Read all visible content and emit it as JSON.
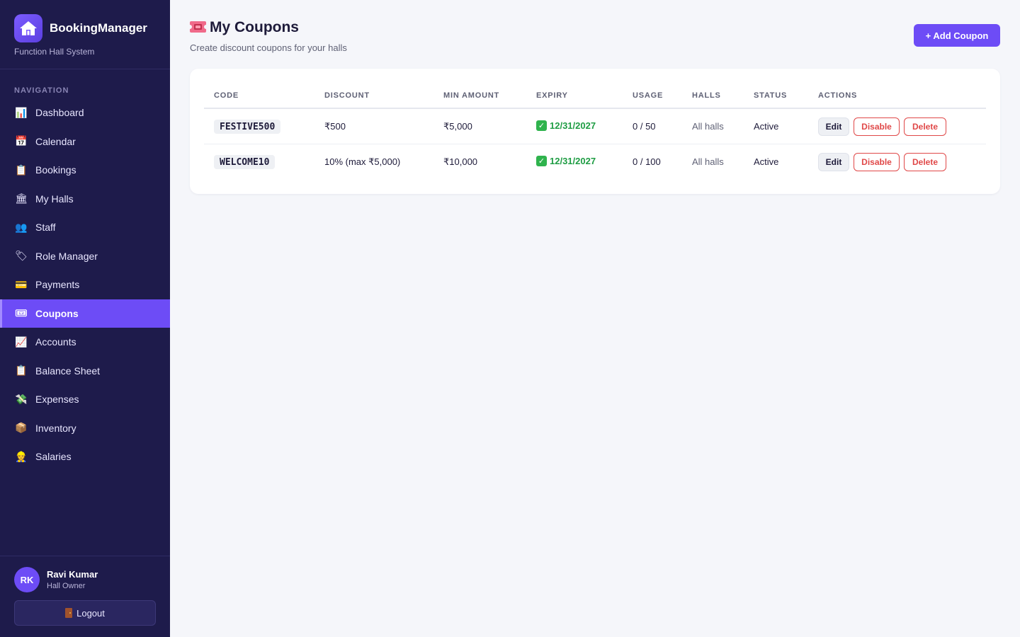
{
  "brand": {
    "title": "BookingManager",
    "subtitle": "Function Hall System"
  },
  "nav": {
    "heading": "NAVIGATION",
    "items": [
      {
        "label": "Dashboard",
        "icon": "📊",
        "icon_name": "bar-chart-icon",
        "active": false
      },
      {
        "label": "Calendar",
        "icon": "📅",
        "icon_name": "calendar-icon",
        "active": false
      },
      {
        "label": "Bookings",
        "icon": "📋",
        "icon_name": "clipboard-icon",
        "active": false
      },
      {
        "label": "My Halls",
        "icon": "🏛",
        "icon_name": "building-icon",
        "active": false
      },
      {
        "label": "Staff",
        "icon": "👥",
        "icon_name": "people-icon",
        "active": false
      },
      {
        "label": "Role Manager",
        "icon": "🏷",
        "icon_name": "tag-icon",
        "active": false
      },
      {
        "label": "Payments",
        "icon": "💳",
        "icon_name": "credit-card-icon",
        "active": false
      },
      {
        "label": "Coupons",
        "icon": "🎟",
        "icon_name": "ticket-icon",
        "active": true
      },
      {
        "label": "Accounts",
        "icon": "📈",
        "icon_name": "trend-chart-icon",
        "active": false
      },
      {
        "label": "Balance Sheet",
        "icon": "📋",
        "icon_name": "clipboard-icon",
        "active": false
      },
      {
        "label": "Expenses",
        "icon": "💸",
        "icon_name": "money-wings-icon",
        "active": false
      },
      {
        "label": "Inventory",
        "icon": "📦",
        "icon_name": "package-icon",
        "active": false
      },
      {
        "label": "Salaries",
        "icon": "👷",
        "icon_name": "worker-icon",
        "active": false
      }
    ]
  },
  "user": {
    "initials": "RK",
    "name": "Ravi Kumar",
    "role": "Hall Owner"
  },
  "logout": {
    "label": "Logout"
  },
  "page": {
    "title": "My Coupons",
    "subtitle": "Create discount coupons for your halls",
    "add_button": "+ Add Coupon"
  },
  "table": {
    "columns": [
      "CODE",
      "DISCOUNT",
      "MIN AMOUNT",
      "EXPIRY",
      "USAGE",
      "HALLS",
      "STATUS",
      "ACTIONS"
    ],
    "rows": [
      {
        "code": "FESTIVE500",
        "discount": "₹500",
        "min_amount": "₹5,000",
        "expiry": "12/31/2027",
        "usage": "0 / 50",
        "halls": "All halls",
        "status": "Active",
        "edit": "Edit",
        "disable": "Disable",
        "delete": "Delete"
      },
      {
        "code": "WELCOME10",
        "discount": "10% (max ₹5,000)",
        "min_amount": "₹10,000",
        "expiry": "12/31/2027",
        "usage": "0 / 100",
        "halls": "All halls",
        "status": "Active",
        "edit": "Edit",
        "disable": "Disable",
        "delete": "Delete"
      }
    ]
  },
  "colors": {
    "sidebar_bg": "#1e1b4b",
    "accent": "#6d4cf6",
    "danger": "#e04848",
    "success": "#1f9d44"
  }
}
